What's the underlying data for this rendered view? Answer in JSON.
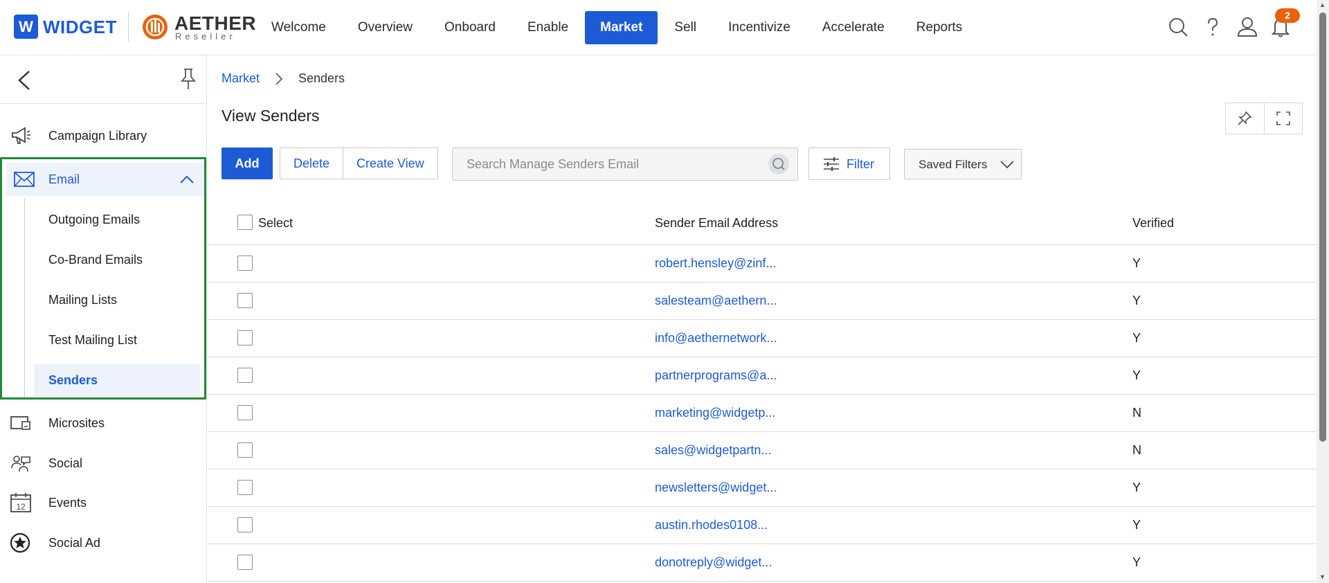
{
  "header": {
    "logo_letter": "W",
    "logo_text": "WIDGET",
    "partner_title": "AETHER",
    "partner_subtitle": "Reseller",
    "nav": [
      "Welcome",
      "Overview",
      "Onboard",
      "Enable",
      "Market",
      "Sell",
      "Incentivize",
      "Accelerate",
      "Reports"
    ],
    "active_nav": "Market",
    "notification_count": "2",
    "brand_color": "#1d5bd6",
    "badge_color": "#e8620c"
  },
  "sidebar": {
    "items_top": [
      {
        "label": "Campaign Library",
        "icon": "megaphone-icon"
      }
    ],
    "email": {
      "label": "Email",
      "icon": "envelope-icon",
      "expanded": true,
      "children": [
        "Outgoing Emails",
        "Co-Brand Emails",
        "Mailing Lists",
        "Test Mailing List",
        "Senders"
      ],
      "active_child": "Senders"
    },
    "items_bottom": [
      {
        "label": "Microsites",
        "icon": "microsite-icon"
      },
      {
        "label": "Social",
        "icon": "social-icon"
      },
      {
        "label": "Events",
        "icon": "calendar-icon",
        "icon_text": "12"
      },
      {
        "label": "Social Ad",
        "icon": "star-badge-icon"
      }
    ],
    "highlight_color": "#1f8a3a"
  },
  "breadcrumb": {
    "parent": "Market",
    "current": "Senders"
  },
  "page_title": "View Senders",
  "toolbar": {
    "add_label": "Add",
    "delete_label": "Delete",
    "create_view_label": "Create View",
    "search_placeholder": "Search Manage Senders Email",
    "filter_label": "Filter",
    "saved_filters_label": "Saved Filters"
  },
  "table": {
    "columns": [
      "Select",
      "Sender Email Address",
      "Verified"
    ],
    "rows": [
      {
        "email": "robert.hensley@zinf...",
        "verified": "Y"
      },
      {
        "email": "salesteam@aethern...",
        "verified": "Y"
      },
      {
        "email": "info@aethernetwork...",
        "verified": "Y"
      },
      {
        "email": "partnerprograms@a...",
        "verified": "Y"
      },
      {
        "email": "marketing@widgetp...",
        "verified": "N"
      },
      {
        "email": "sales@widgetpartn...",
        "verified": "N"
      },
      {
        "email": "newsletters@widget...",
        "verified": "Y"
      },
      {
        "email": "austin.rhodes0108...",
        "verified": "Y"
      },
      {
        "email": "donotreply@widget...",
        "verified": "Y"
      }
    ]
  }
}
